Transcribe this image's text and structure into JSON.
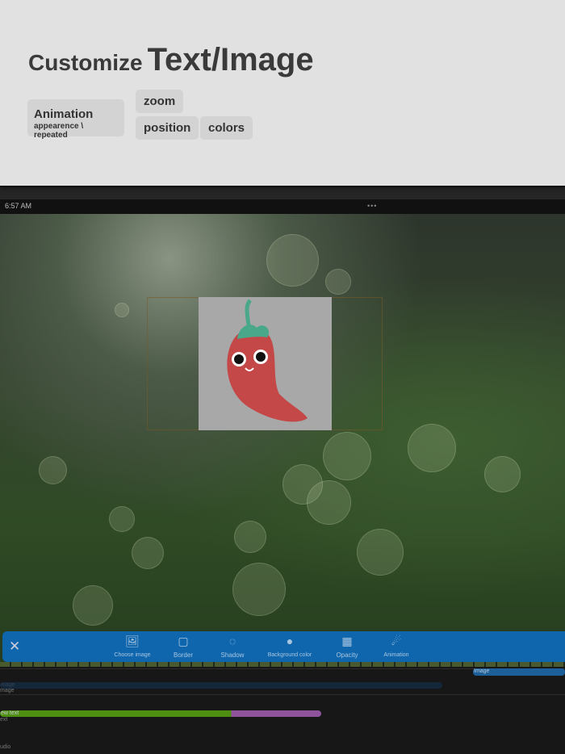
{
  "promo": {
    "title_small": "Customize",
    "title_big": "Text/Image",
    "chips": {
      "animation": "Animation",
      "animation_sub": "appearence \\ repeated",
      "zoom": "zoom",
      "position": "position",
      "colors": "colors"
    }
  },
  "status": {
    "time": "6:57 AM",
    "more": "•••"
  },
  "toolbar": {
    "close": "✕",
    "items": [
      {
        "label": "Choose image",
        "icon": "image-plus-icon"
      },
      {
        "label": "Border",
        "icon": "border-icon"
      },
      {
        "label": "Shadow",
        "icon": "shadow-icon"
      },
      {
        "label": "Background color",
        "icon": "palette-icon"
      },
      {
        "label": "Opacity",
        "icon": "opacity-icon"
      },
      {
        "label": "Animation",
        "icon": "animation-icon"
      }
    ]
  },
  "timeline": {
    "image_clip_top": "Image",
    "image_track_clip": "mage",
    "image_track": "mage",
    "text_clip": "ew text",
    "text_track": "ext",
    "audio_track": "udio"
  },
  "colors": {
    "toolbar": "#0f66ad",
    "text_clip_green": "#4e8e10",
    "text_clip_purple": "#8e539b"
  }
}
